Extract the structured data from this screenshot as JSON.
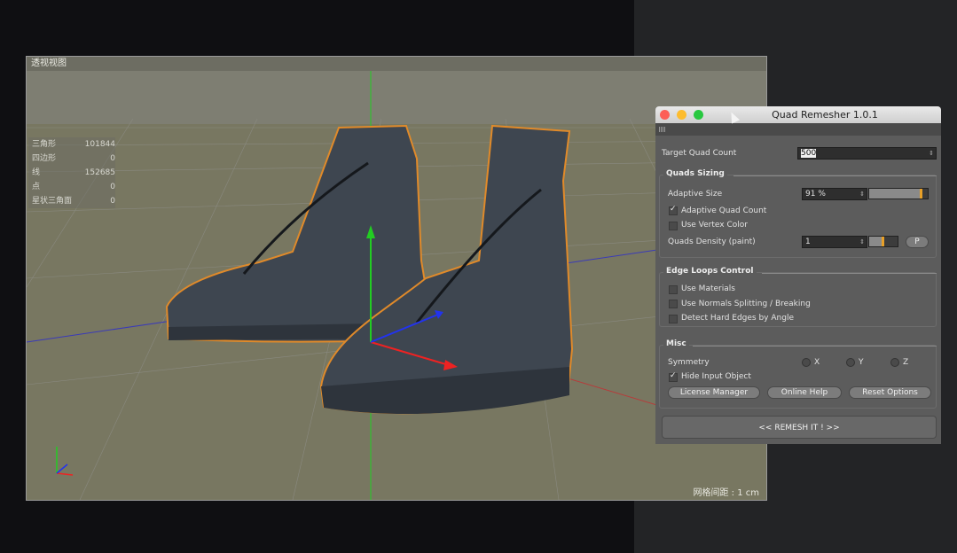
{
  "viewport": {
    "title": "透视视图",
    "stats": [
      {
        "label": "三角形",
        "value": "101844"
      },
      {
        "label": "四边形",
        "value": "0"
      },
      {
        "label": "线",
        "value": "152685"
      },
      {
        "label": "点",
        "value": "0"
      },
      {
        "label": "星状三角面",
        "value": "0"
      }
    ],
    "grid_spacing": "网格间距 : 1 cm"
  },
  "plugin": {
    "title": "Quad Remesher 1.0.1",
    "target_quad_count_label": "Target Quad Count",
    "target_quad_count_value": "500",
    "quads_sizing": {
      "title": "Quads Sizing",
      "adaptive_size_label": "Adaptive Size",
      "adaptive_size_value": "91 %",
      "adaptive_size_level": 0.91,
      "adaptive_quad_count_label": "Adaptive Quad Count",
      "adaptive_quad_count_checked": true,
      "use_vertex_color_label": "Use Vertex Color",
      "use_vertex_color_checked": false,
      "quads_density_label": "Quads Density (paint)",
      "quads_density_value": "1",
      "paint_button": "P"
    },
    "edge_loops": {
      "title": "Edge Loops Control",
      "use_materials_label": "Use Materials",
      "use_normals_label": "Use Normals Splitting / Breaking",
      "detect_hard_edges_label": "Detect Hard Edges by Angle"
    },
    "misc": {
      "title": "Misc",
      "symmetry_label": "Symmetry",
      "sym_x": "X",
      "sym_y": "Y",
      "sym_z": "Z",
      "hide_input_label": "Hide Input Object",
      "hide_input_checked": true,
      "license_manager": "License Manager",
      "online_help": "Online Help",
      "reset_options": "Reset Options"
    },
    "remesh_button": "<<   REMESH IT !   >>"
  },
  "colors": {
    "viewport_bg": "#787761",
    "mesh": "#3e4650",
    "selection_outline": "#e08a2a",
    "accent_handle": "#e8a028",
    "axis_y": "#22cc22",
    "axis_x": "#ee2222",
    "axis_z": "#2233ee"
  }
}
